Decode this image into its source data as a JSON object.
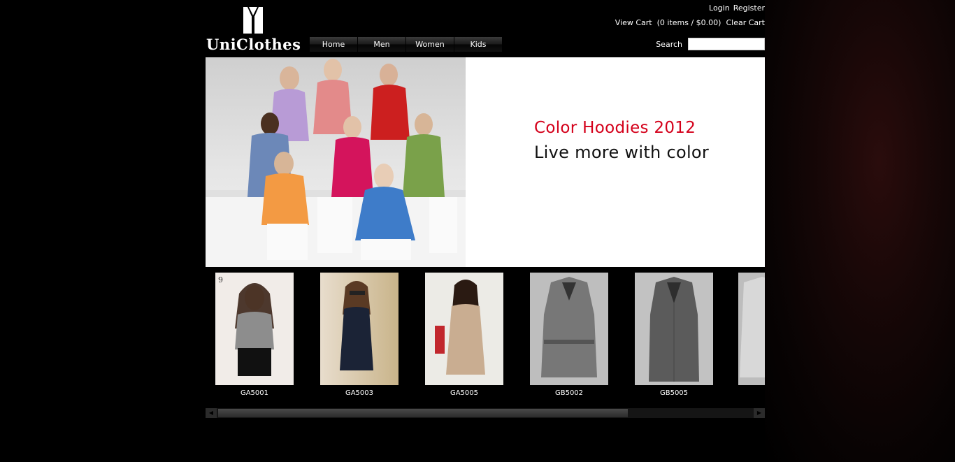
{
  "brand": {
    "name": "UniClothes"
  },
  "nav": [
    {
      "label": "Home"
    },
    {
      "label": "Men"
    },
    {
      "label": "Women"
    },
    {
      "label": "Kids"
    }
  ],
  "account": {
    "login": "Login",
    "register": "Register"
  },
  "cart": {
    "view": "View Cart",
    "summary": "(0 items / $0.00)",
    "clear": "Clear Cart"
  },
  "search": {
    "label": "Search",
    "value": ""
  },
  "banner": {
    "title": "Color Hoodies 2012",
    "subtitle": "Live more with color",
    "title_color": "#d4001a"
  },
  "products": [
    {
      "code": "GA5001"
    },
    {
      "code": "GA5003"
    },
    {
      "code": "GA5005"
    },
    {
      "code": "GB5002"
    },
    {
      "code": "GB5005"
    }
  ]
}
